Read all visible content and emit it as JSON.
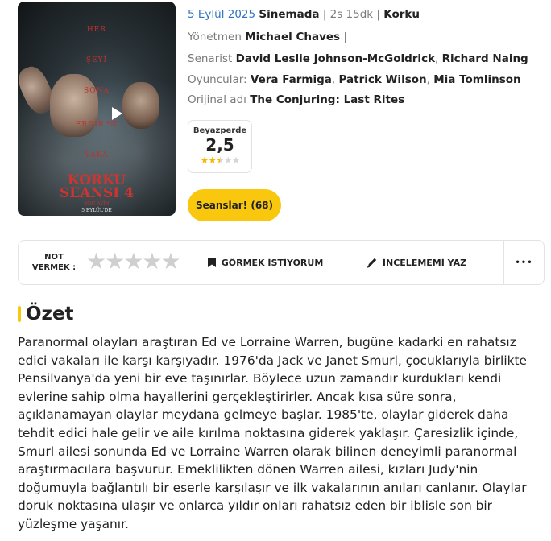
{
  "poster": {
    "taglines": [
      "HER",
      "ŞEYİ",
      "SONA",
      "ERDİREN",
      "VAKA"
    ],
    "title_line1": "KORKU",
    "title_line2": "SEANSI 4",
    "subtitle": "SON AYİN",
    "date": "5 EYLÜL'DE"
  },
  "meta": {
    "release_date": "5 Eylül 2025",
    "category": "Sinemada",
    "duration": "2s 15dk",
    "genre": "Korku",
    "director_label": "Yönetmen",
    "director": "Michael Chaves",
    "writer_label": "Senarist",
    "writers": [
      "David Leslie Johnson-McGoldrick",
      "Richard Naing"
    ],
    "cast_label": "Oyuncular:",
    "cast": [
      "Vera Farmiga",
      "Patrick Wilson",
      "Mia Tomlinson"
    ],
    "original_title_label": "Orijinal adı",
    "original_title": "The Conjuring: Last Rites"
  },
  "rating": {
    "source": "Beyazperde",
    "score": "2,5",
    "stars_value": 2.5,
    "stars_max": 5
  },
  "sessions_button": "Seanslar! (68)",
  "actions": {
    "rate_label_line1": "NOT",
    "rate_label_line2": "VERMEK :",
    "watchlist": "GÖRMEK İSTİYORUM",
    "review": "İNCELEMEMİ YAZ",
    "more": "•••"
  },
  "summary": {
    "title": "Özet",
    "text": "Paranormal olayları araştıran Ed ve Lorraine Warren, bugüne kadarki en rahatsız edici vakaları ile karşı karşıyadır. 1976'da Jack ve Janet Smurl, çocuklarıyla birlikte Pensilvanya'da yeni bir eve taşınırlar. Böylece uzun zamandır kurdukları kendi evlerine sahip olma hayallerini gerçekleştirirler. Ancak kısa süre sonra, açıklanamayan olaylar meydana gelmeye başlar. 1985'te, olaylar giderek daha tehdit edici hale gelir ve aile kırılma noktasına giderek yaklaşır. Çaresizlik içinde, Smurl ailesi sonunda Ed ve Lorraine Warren olarak bilinen deneyimli paranormal araştırmacılara başvurur. Emeklilikten dönen Warren ailesi, kızları Judy'nin doğumuyla bağlantılı bir eserle karşılaşır ve ilk vakalarının anıları canlanır. Olaylar doruk noktasına ulaşır ve onlarca yıldır onları rahatsız eden bir iblisle son bir yüzleşme yaşanır."
  },
  "colors": {
    "accent_blue": "#2f74c0",
    "accent_yellow": "#f9c80e",
    "star_on": "#f5b800",
    "star_off": "#d6d6d6"
  }
}
